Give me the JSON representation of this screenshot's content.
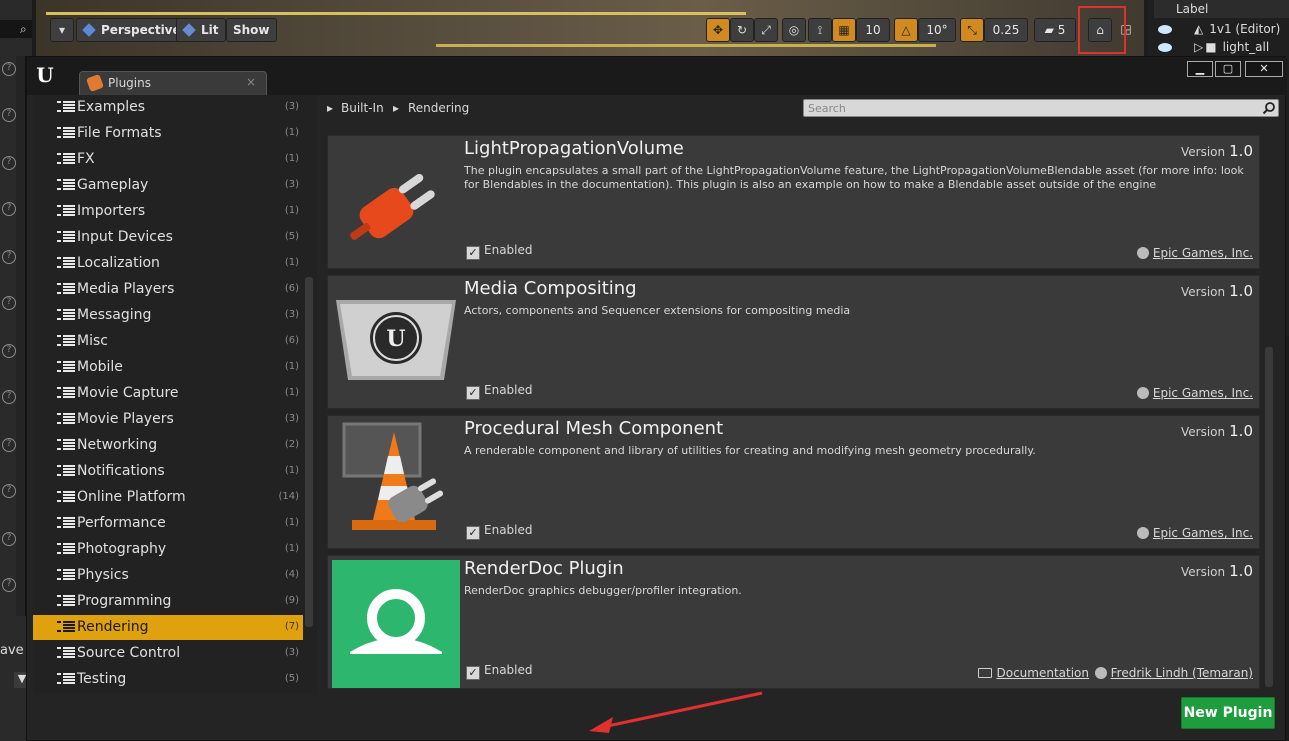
{
  "background": {
    "viewport_toolbar": {
      "perspective_label": "Perspective",
      "lit_label": "Lit",
      "show_label": "Show",
      "grid_value": "10",
      "rotation_value": "10°",
      "scale_value": "0.25",
      "camera_speed_value": "5"
    },
    "outliner": {
      "header_label": "Label",
      "rows": [
        {
          "label": "1v1 (Editor)"
        },
        {
          "label": "light_all"
        }
      ]
    },
    "left_panel_label": "ave A"
  },
  "window": {
    "tab_label": "Plugins",
    "tab_close": "×",
    "minimize": "▁",
    "maximize": "▢",
    "close": "✕"
  },
  "sidebar": {
    "categories": [
      {
        "label": "Examples",
        "count": "(3)",
        "selected": false
      },
      {
        "label": "File Formats",
        "count": "(1)",
        "selected": false
      },
      {
        "label": "FX",
        "count": "(1)",
        "selected": false
      },
      {
        "label": "Gameplay",
        "count": "(3)",
        "selected": false
      },
      {
        "label": "Importers",
        "count": "(1)",
        "selected": false
      },
      {
        "label": "Input Devices",
        "count": "(5)",
        "selected": false
      },
      {
        "label": "Localization",
        "count": "(1)",
        "selected": false
      },
      {
        "label": "Media Players",
        "count": "(6)",
        "selected": false
      },
      {
        "label": "Messaging",
        "count": "(3)",
        "selected": false
      },
      {
        "label": "Misc",
        "count": "(6)",
        "selected": false
      },
      {
        "label": "Mobile",
        "count": "(1)",
        "selected": false
      },
      {
        "label": "Movie Capture",
        "count": "(1)",
        "selected": false
      },
      {
        "label": "Movie Players",
        "count": "(3)",
        "selected": false
      },
      {
        "label": "Networking",
        "count": "(2)",
        "selected": false
      },
      {
        "label": "Notifications",
        "count": "(1)",
        "selected": false
      },
      {
        "label": "Online Platform",
        "count": "(14)",
        "selected": false
      },
      {
        "label": "Performance",
        "count": "(1)",
        "selected": false
      },
      {
        "label": "Photography",
        "count": "(1)",
        "selected": false
      },
      {
        "label": "Physics",
        "count": "(4)",
        "selected": false
      },
      {
        "label": "Programming",
        "count": "(9)",
        "selected": false
      },
      {
        "label": "Rendering",
        "count": "(7)",
        "selected": true
      },
      {
        "label": "Source Control",
        "count": "(3)",
        "selected": false
      },
      {
        "label": "Testing",
        "count": "(5)",
        "selected": false
      }
    ]
  },
  "breadcrumb": {
    "items": [
      "Built-In",
      "Rendering"
    ]
  },
  "search": {
    "placeholder": "Search"
  },
  "plugins": [
    {
      "name": "LightPropagationVolume",
      "version_label": "Version",
      "version": "1.0",
      "description": "The plugin encapsulates a small part of the LightPropagationVolume feature, the LightPropagationVolumeBlendable asset (for more info: look for Blendables in the documentation). This plugin is also an example on how to make a Blendable asset outside of the engine",
      "enabled_label": "Enabled",
      "enabled": true,
      "vendor": "Epic Games, Inc.",
      "thumb_icon": "plug-icon"
    },
    {
      "name": "Media Compositing",
      "version_label": "Version",
      "version": "1.0",
      "description": "Actors, components and Sequencer extensions for compositing media",
      "enabled_label": "Enabled",
      "enabled": true,
      "vendor": "Epic Games, Inc.",
      "thumb_icon": "unreal-logo-icon"
    },
    {
      "name": "Procedural Mesh Component",
      "version_label": "Version",
      "version": "1.0",
      "description": "A renderable component and library of utilities for creating and modifying mesh geometry procedurally.",
      "enabled_label": "Enabled",
      "enabled": true,
      "vendor": "Epic Games, Inc.",
      "thumb_icon": "traffic-cone-plug-icon"
    },
    {
      "name": "RenderDoc Plugin",
      "version_label": "Version",
      "version": "1.0",
      "description": "RenderDoc graphics debugger/profiler integration.",
      "enabled_label": "Enabled",
      "enabled": true,
      "docs_label": "Documentation",
      "vendor": "Fredrik Lindh (Temaran)",
      "thumb_icon": "renderdoc-icon",
      "thumb_color": "#2db66e"
    }
  ],
  "new_plugin_label": "New Plugin",
  "colors": {
    "selected_category": "#e0a10e",
    "new_plugin_button": "#1e9d3e",
    "annotation_red": "#e03030",
    "renderdoc_green": "#2db66e",
    "plug_orange": "#e8491c"
  }
}
